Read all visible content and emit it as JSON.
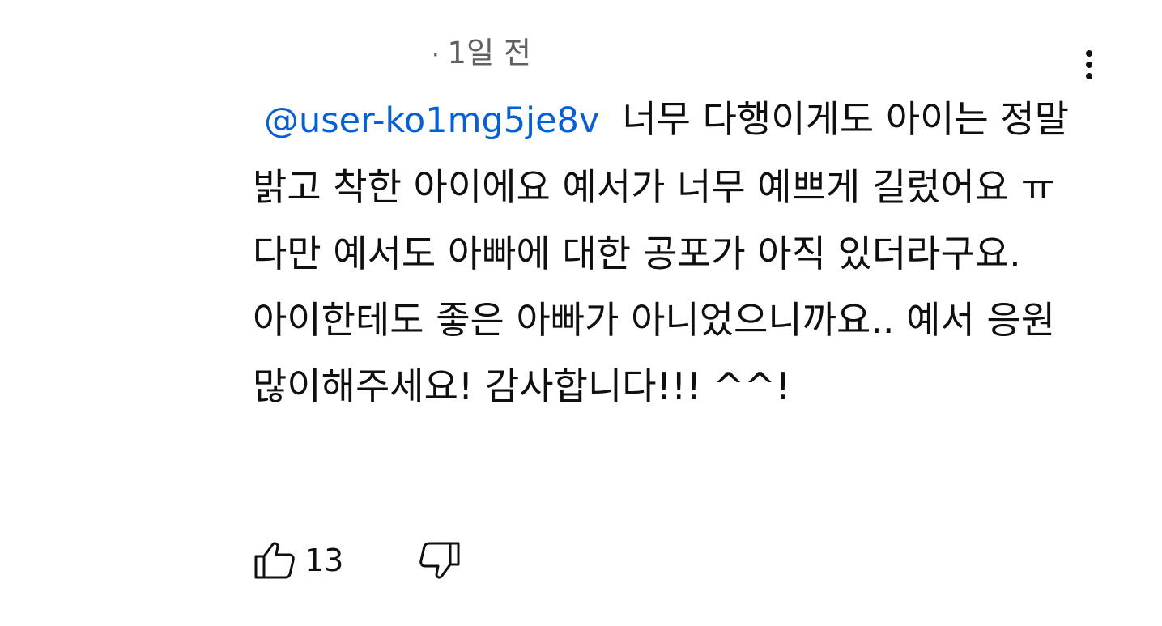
{
  "comment": {
    "timestamp_separator": "·",
    "timestamp": "1일 전",
    "mention": "@user-ko1mg5je8v",
    "text": "너무 다행이게도 아이는 정말 밝고 착한 아이에요 예서가 너무 예쁘게 길렀어요 ㅠ 다만 예서도 아빠에 대한 공포가 아직 있더라구요. 아이한테도 좋은 아빠가 아니었으니까요.. 예서 응원 많이해주세요! 감사합니다!!! ^^!",
    "like_count": "13"
  },
  "icons": {
    "more": "more-vert-icon",
    "like": "thumb-up-icon",
    "dislike": "thumb-down-icon"
  },
  "colors": {
    "mention": "#065fd4",
    "meta_text": "#606060",
    "body_text": "#0f0f0f"
  }
}
